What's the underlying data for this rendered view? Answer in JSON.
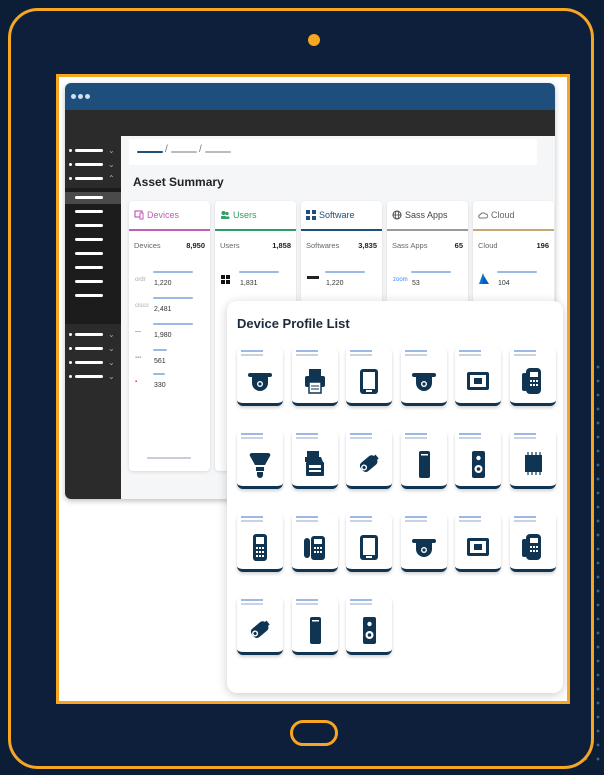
{
  "breadcrumb": [
    "",
    "",
    ""
  ],
  "page_title": "Asset Summary",
  "cards": [
    {
      "title": "Devices",
      "color": "#c05fb3",
      "label": "Devices",
      "total": "8,950",
      "items": [
        {
          "logo": "ordr",
          "value": "1,220"
        },
        {
          "logo": "cisco",
          "value": "2,481"
        },
        {
          "logo": "",
          "value": "1,980"
        },
        {
          "logo": "",
          "value": "561"
        },
        {
          "logo": "",
          "value": "330"
        }
      ]
    },
    {
      "title": "Users",
      "color": "#2e9d63",
      "label": "Users",
      "total": "1,858",
      "items": [
        {
          "logo": "windows",
          "value": "1,831"
        }
      ]
    },
    {
      "title": "Software",
      "color": "#1d4e7c",
      "label": "Softwares",
      "total": "3,835",
      "items": [
        {
          "logo": "",
          "value": "1,220"
        }
      ]
    },
    {
      "title": "Sass Apps",
      "color": "#888",
      "label": "Sass Apps",
      "total": "65",
      "items": [
        {
          "logo": "zoom",
          "value": "53"
        }
      ]
    },
    {
      "title": "Cloud",
      "color": "#c8a872",
      "label": "Cloud",
      "total": "196",
      "items": [
        {
          "logo": "azure",
          "value": "104"
        }
      ]
    }
  ],
  "overlay": {
    "title": "Device Profile List",
    "devices": [
      "camera-dome-icon",
      "printer-icon",
      "tablet-icon",
      "camera-dome-icon",
      "monitor-icon",
      "ip-phone-icon",
      "smart-bulb-icon",
      "multifunction-printer-icon",
      "camera-bullet-icon",
      "server-tower-icon",
      "speaker-icon",
      "chip-icon",
      "pos-terminal-icon",
      "fax-phone-icon",
      "tablet-icon",
      "camera-dome-icon",
      "monitor-icon",
      "ip-phone-icon",
      "camera-bullet-icon",
      "server-tower-icon",
      "speaker-icon"
    ]
  },
  "colors": {
    "accent": "#f6a623",
    "brand": "#1d4e7c",
    "icon": "#0f3553"
  }
}
